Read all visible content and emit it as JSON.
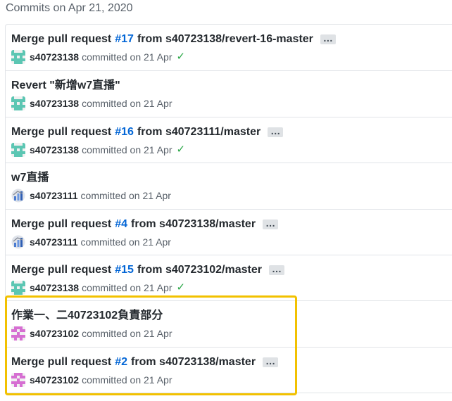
{
  "group_title": "Commits on Apr 21, 2020",
  "colors": {
    "link": "#0366d6",
    "check": "#28a745",
    "highlight": "#f2c100"
  },
  "commits": [
    {
      "title_pre": "Merge pull request",
      "pr": "#17",
      "title_post": "from s40723138/revert-16-master",
      "ellipsis": true,
      "author": "s40723138",
      "meta": "committed on 21 Apr",
      "status": "✓",
      "avatar": "teal-identicon"
    },
    {
      "title_pre": "Revert \"新增w7直播\"",
      "pr": "",
      "title_post": "",
      "ellipsis": false,
      "author": "s40723138",
      "meta": "committed on 21 Apr",
      "status": "",
      "avatar": "teal-identicon"
    },
    {
      "title_pre": "Merge pull request",
      "pr": "#16",
      "title_post": "from s40723111/master",
      "ellipsis": true,
      "author": "s40723138",
      "meta": "committed on 21 Apr",
      "status": "✓",
      "avatar": "teal-identicon"
    },
    {
      "title_pre": "w7直播",
      "pr": "",
      "title_post": "",
      "ellipsis": false,
      "author": "s40723111",
      "meta": "committed on 21 Apr",
      "status": "",
      "avatar": "chart-avatar"
    },
    {
      "title_pre": "Merge pull request",
      "pr": "#4",
      "title_post": "from s40723138/master",
      "ellipsis": true,
      "author": "s40723111",
      "meta": "committed on 21 Apr",
      "status": "",
      "avatar": "chart-avatar"
    },
    {
      "title_pre": "Merge pull request",
      "pr": "#15",
      "title_post": "from s40723102/master",
      "ellipsis": true,
      "author": "s40723138",
      "meta": "committed on 21 Apr",
      "status": "✓",
      "avatar": "teal-identicon"
    },
    {
      "title_pre": "作業一、二40723102負責部分",
      "pr": "",
      "title_post": "",
      "ellipsis": false,
      "author": "s40723102",
      "meta": "committed on 21 Apr",
      "status": "",
      "avatar": "pink-identicon"
    },
    {
      "title_pre": "Merge pull request",
      "pr": "#2",
      "title_post": "from s40723138/master",
      "ellipsis": true,
      "author": "s40723102",
      "meta": "committed on 21 Apr",
      "status": "",
      "avatar": "pink-identicon"
    }
  ]
}
